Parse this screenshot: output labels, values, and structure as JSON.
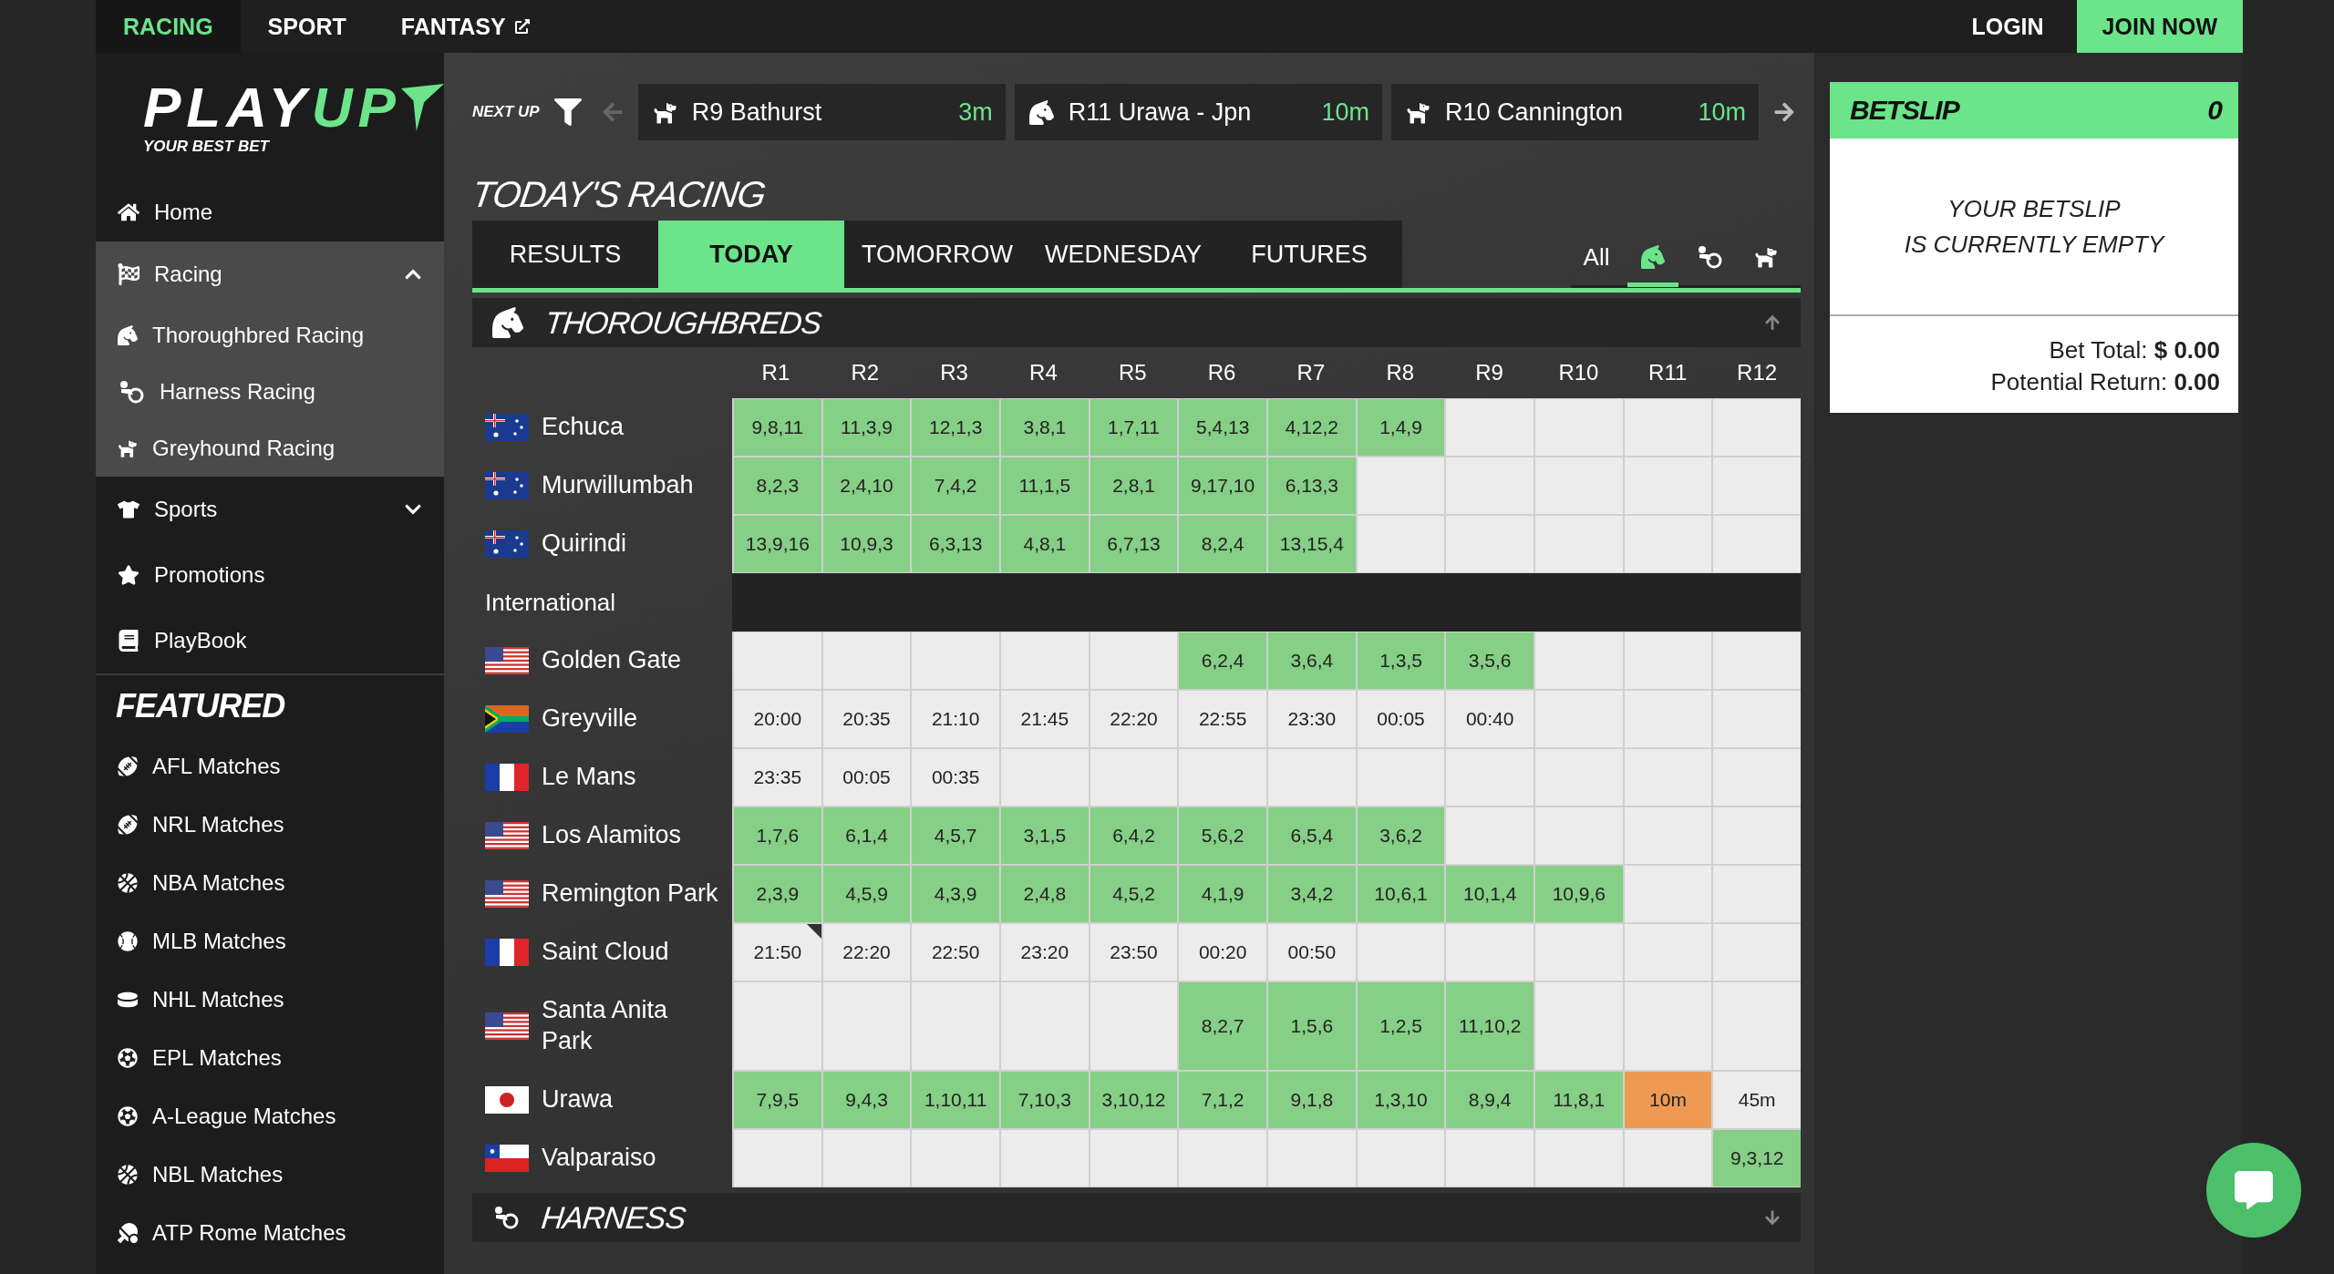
{
  "top_nav": {
    "tabs": [
      {
        "label": "RACING",
        "selected": true
      },
      {
        "label": "SPORT",
        "selected": false
      },
      {
        "label": "FANTASY",
        "selected": false,
        "external": true
      }
    ],
    "login": "LOGIN",
    "join": "JOIN NOW"
  },
  "logo": {
    "primary": "PLAY",
    "accent": "UP",
    "tagline": "YOUR BEST BET"
  },
  "sidebar": {
    "items": [
      {
        "label": "Home"
      },
      {
        "label": "Racing",
        "expanded": true,
        "children": [
          {
            "label": "Thoroughbred Racing"
          },
          {
            "label": "Harness Racing"
          },
          {
            "label": "Greyhound Racing"
          }
        ]
      },
      {
        "label": "Sports",
        "expanded": false
      },
      {
        "label": "Promotions"
      },
      {
        "label": "PlayBook"
      }
    ],
    "featured_title": "FEATURED",
    "featured": [
      "AFL Matches",
      "NRL Matches",
      "NBA Matches",
      "MLB Matches",
      "NHL Matches",
      "EPL Matches",
      "A-League Matches",
      "NBL Matches",
      "ATP Rome Matches"
    ]
  },
  "next_up": {
    "label": "NEXT UP",
    "races": [
      {
        "kind": "greyhound",
        "name": "R9 Bathurst",
        "time": "3m"
      },
      {
        "kind": "thoroughbred",
        "name": "R11 Urawa - Jpn",
        "time": "10m"
      },
      {
        "kind": "greyhound",
        "name": "R10 Cannington",
        "time": "10m"
      }
    ]
  },
  "racing": {
    "title": "TODAY'S RACING",
    "tabs": [
      {
        "label": "RESULTS",
        "selected": false
      },
      {
        "label": "TODAY",
        "selected": true
      },
      {
        "label": "TOMORROW",
        "selected": false
      },
      {
        "label": "WEDNESDAY",
        "selected": false
      },
      {
        "label": "FUTURES",
        "selected": false
      }
    ],
    "filters": [
      {
        "kind": "all",
        "label": "All",
        "selected": false
      },
      {
        "kind": "thoroughbred",
        "selected": true
      },
      {
        "kind": "harness",
        "selected": false
      },
      {
        "kind": "greyhound",
        "selected": false
      }
    ],
    "sections": [
      {
        "kind": "thoroughbred",
        "title": "THOROUGHBREDS",
        "expanded": true,
        "columns": [
          "R1",
          "R2",
          "R3",
          "R4",
          "R5",
          "R6",
          "R7",
          "R8",
          "R9",
          "R10",
          "R11",
          "R12"
        ],
        "rows": [
          {
            "kind": "venue",
            "name": "Echuca",
            "flag": {
              "kind": "au"
            },
            "cells": [
              {
                "kind": "result",
                "text": "9,8,11"
              },
              {
                "kind": "result",
                "text": "11,3,9"
              },
              {
                "kind": "result",
                "text": "12,1,3"
              },
              {
                "kind": "result",
                "text": "3,8,1"
              },
              {
                "kind": "result",
                "text": "1,7,11"
              },
              {
                "kind": "result",
                "text": "5,4,13"
              },
              {
                "kind": "result",
                "text": "4,12,2"
              },
              {
                "kind": "result",
                "text": "1,4,9"
              },
              {
                "kind": "empty"
              },
              {
                "kind": "empty"
              },
              {
                "kind": "empty"
              },
              {
                "kind": "empty"
              }
            ]
          },
          {
            "kind": "venue",
            "name": "Murwillumbah",
            "flag": {
              "kind": "au"
            },
            "cells": [
              {
                "kind": "result",
                "text": "8,2,3"
              },
              {
                "kind": "result",
                "text": "2,4,10"
              },
              {
                "kind": "result",
                "text": "7,4,2"
              },
              {
                "kind": "result",
                "text": "11,1,5"
              },
              {
                "kind": "result",
                "text": "2,8,1"
              },
              {
                "kind": "result",
                "text": "9,17,10"
              },
              {
                "kind": "result",
                "text": "6,13,3"
              },
              {
                "kind": "empty"
              },
              {
                "kind": "empty"
              },
              {
                "kind": "empty"
              },
              {
                "kind": "empty"
              },
              {
                "kind": "empty"
              }
            ]
          },
          {
            "kind": "venue",
            "name": "Quirindi",
            "flag": {
              "kind": "au"
            },
            "cells": [
              {
                "kind": "result",
                "text": "13,9,16"
              },
              {
                "kind": "result",
                "text": "10,9,3"
              },
              {
                "kind": "result",
                "text": "6,3,13"
              },
              {
                "kind": "result",
                "text": "4,8,1"
              },
              {
                "kind": "result",
                "text": "6,7,13"
              },
              {
                "kind": "result",
                "text": "8,2,4"
              },
              {
                "kind": "result",
                "text": "13,15,4"
              },
              {
                "kind": "empty"
              },
              {
                "kind": "empty"
              },
              {
                "kind": "empty"
              },
              {
                "kind": "empty"
              },
              {
                "kind": "empty"
              }
            ]
          },
          {
            "kind": "group",
            "label": "International"
          },
          {
            "kind": "venue",
            "name": "Golden Gate",
            "flag": {
              "kind": "us"
            },
            "cells": [
              {
                "kind": "empty"
              },
              {
                "kind": "empty"
              },
              {
                "kind": "empty"
              },
              {
                "kind": "empty"
              },
              {
                "kind": "empty"
              },
              {
                "kind": "result",
                "text": "6,2,4"
              },
              {
                "kind": "result",
                "text": "3,6,4"
              },
              {
                "kind": "result",
                "text": "1,3,5"
              },
              {
                "kind": "result",
                "text": "3,5,6"
              },
              {
                "kind": "empty"
              },
              {
                "kind": "empty"
              },
              {
                "kind": "empty"
              }
            ]
          },
          {
            "kind": "venue",
            "name": "Greyville",
            "flag": {
              "kind": "za"
            },
            "cells": [
              {
                "kind": "open",
                "text": "20:00"
              },
              {
                "kind": "open",
                "text": "20:35"
              },
              {
                "kind": "open",
                "text": "21:10"
              },
              {
                "kind": "open",
                "text": "21:45"
              },
              {
                "kind": "open",
                "text": "22:20"
              },
              {
                "kind": "open",
                "text": "22:55"
              },
              {
                "kind": "open",
                "text": "23:30"
              },
              {
                "kind": "open",
                "text": "00:05"
              },
              {
                "kind": "open",
                "text": "00:40"
              },
              {
                "kind": "empty"
              },
              {
                "kind": "empty"
              },
              {
                "kind": "empty"
              }
            ]
          },
          {
            "kind": "venue",
            "name": "Le Mans",
            "flag": {
              "kind": "fr"
            },
            "cells": [
              {
                "kind": "open",
                "text": "23:35"
              },
              {
                "kind": "open",
                "text": "00:05"
              },
              {
                "kind": "open",
                "text": "00:35"
              },
              {
                "kind": "empty"
              },
              {
                "kind": "empty"
              },
              {
                "kind": "empty"
              },
              {
                "kind": "empty"
              },
              {
                "kind": "empty"
              },
              {
                "kind": "empty"
              },
              {
                "kind": "empty"
              },
              {
                "kind": "empty"
              },
              {
                "kind": "empty"
              }
            ]
          },
          {
            "kind": "venue",
            "name": "Los Alamitos",
            "flag": {
              "kind": "us"
            },
            "cells": [
              {
                "kind": "result",
                "text": "1,7,6"
              },
              {
                "kind": "result",
                "text": "6,1,4"
              },
              {
                "kind": "result",
                "text": "4,5,7"
              },
              {
                "kind": "result",
                "text": "3,1,5"
              },
              {
                "kind": "result",
                "text": "6,4,2"
              },
              {
                "kind": "result",
                "text": "5,6,2"
              },
              {
                "kind": "result",
                "text": "6,5,4"
              },
              {
                "kind": "result",
                "text": "3,6,2"
              },
              {
                "kind": "empty"
              },
              {
                "kind": "empty"
              },
              {
                "kind": "empty"
              },
              {
                "kind": "empty"
              }
            ]
          },
          {
            "kind": "venue",
            "name": "Remington Park",
            "flag": {
              "kind": "us"
            },
            "cells": [
              {
                "kind": "result",
                "text": "2,3,9"
              },
              {
                "kind": "result",
                "text": "4,5,9"
              },
              {
                "kind": "result",
                "text": "4,3,9"
              },
              {
                "kind": "result",
                "text": "2,4,8"
              },
              {
                "kind": "result",
                "text": "4,5,2"
              },
              {
                "kind": "result",
                "text": "4,1,9"
              },
              {
                "kind": "result",
                "text": "3,4,2"
              },
              {
                "kind": "result",
                "text": "10,6,1"
              },
              {
                "kind": "result",
                "text": "10,1,4"
              },
              {
                "kind": "result",
                "text": "10,9,6"
              },
              {
                "kind": "empty"
              },
              {
                "kind": "empty"
              }
            ]
          },
          {
            "kind": "venue",
            "name": "Saint Cloud",
            "flag": {
              "kind": "fr"
            },
            "cells": [
              {
                "kind": "open",
                "text": "21:50",
                "marked": true
              },
              {
                "kind": "open",
                "text": "22:20"
              },
              {
                "kind": "open",
                "text": "22:50"
              },
              {
                "kind": "open",
                "text": "23:20"
              },
              {
                "kind": "open",
                "text": "23:50"
              },
              {
                "kind": "open",
                "text": "00:20"
              },
              {
                "kind": "open",
                "text": "00:50"
              },
              {
                "kind": "empty"
              },
              {
                "kind": "empty"
              },
              {
                "kind": "empty"
              },
              {
                "kind": "empty"
              },
              {
                "kind": "empty"
              }
            ]
          },
          {
            "kind": "venue",
            "name": "Santa Anita Park",
            "flag": {
              "kind": "us"
            },
            "cells": [
              {
                "kind": "empty"
              },
              {
                "kind": "empty"
              },
              {
                "kind": "empty"
              },
              {
                "kind": "empty"
              },
              {
                "kind": "empty"
              },
              {
                "kind": "result",
                "text": "8,2,7"
              },
              {
                "kind": "result",
                "text": "1,5,6"
              },
              {
                "kind": "result",
                "text": "1,2,5"
              },
              {
                "kind": "result",
                "text": "11,10,2"
              },
              {
                "kind": "empty"
              },
              {
                "kind": "empty"
              },
              {
                "kind": "empty"
              }
            ]
          },
          {
            "kind": "venue",
            "name": "Urawa",
            "flag": {
              "kind": "jp"
            },
            "cells": [
              {
                "kind": "result",
                "text": "7,9,5"
              },
              {
                "kind": "result",
                "text": "9,4,3"
              },
              {
                "kind": "result",
                "text": "1,10,11"
              },
              {
                "kind": "result",
                "text": "7,10,3"
              },
              {
                "kind": "result",
                "text": "3,10,12"
              },
              {
                "kind": "result",
                "text": "7,1,2"
              },
              {
                "kind": "result",
                "text": "9,1,8"
              },
              {
                "kind": "result",
                "text": "1,3,10"
              },
              {
                "kind": "result",
                "text": "8,9,4"
              },
              {
                "kind": "result",
                "text": "11,8,1"
              },
              {
                "kind": "soon",
                "text": "10m"
              },
              {
                "kind": "open",
                "text": "45m"
              }
            ]
          },
          {
            "kind": "venue",
            "name": "Valparaiso",
            "flag": {
              "kind": "cl"
            },
            "cells": [
              {
                "kind": "empty"
              },
              {
                "kind": "empty"
              },
              {
                "kind": "empty"
              },
              {
                "kind": "empty"
              },
              {
                "kind": "empty"
              },
              {
                "kind": "empty"
              },
              {
                "kind": "empty"
              },
              {
                "kind": "empty"
              },
              {
                "kind": "empty"
              },
              {
                "kind": "empty"
              },
              {
                "kind": "empty"
              },
              {
                "kind": "result",
                "text": "9,3,12"
              }
            ]
          }
        ]
      },
      {
        "kind": "harness",
        "title": "HARNESS",
        "expanded": false
      }
    ]
  },
  "betslip": {
    "title": "BETSLIP",
    "count": "0",
    "empty_lines": [
      "YOUR BETSLIP",
      "IS CURRENTLY EMPTY"
    ],
    "totals": [
      {
        "label": "Bet Total:",
        "value": "$ 0.00"
      },
      {
        "label": "Potential Return:",
        "value": "0.00"
      }
    ]
  }
}
